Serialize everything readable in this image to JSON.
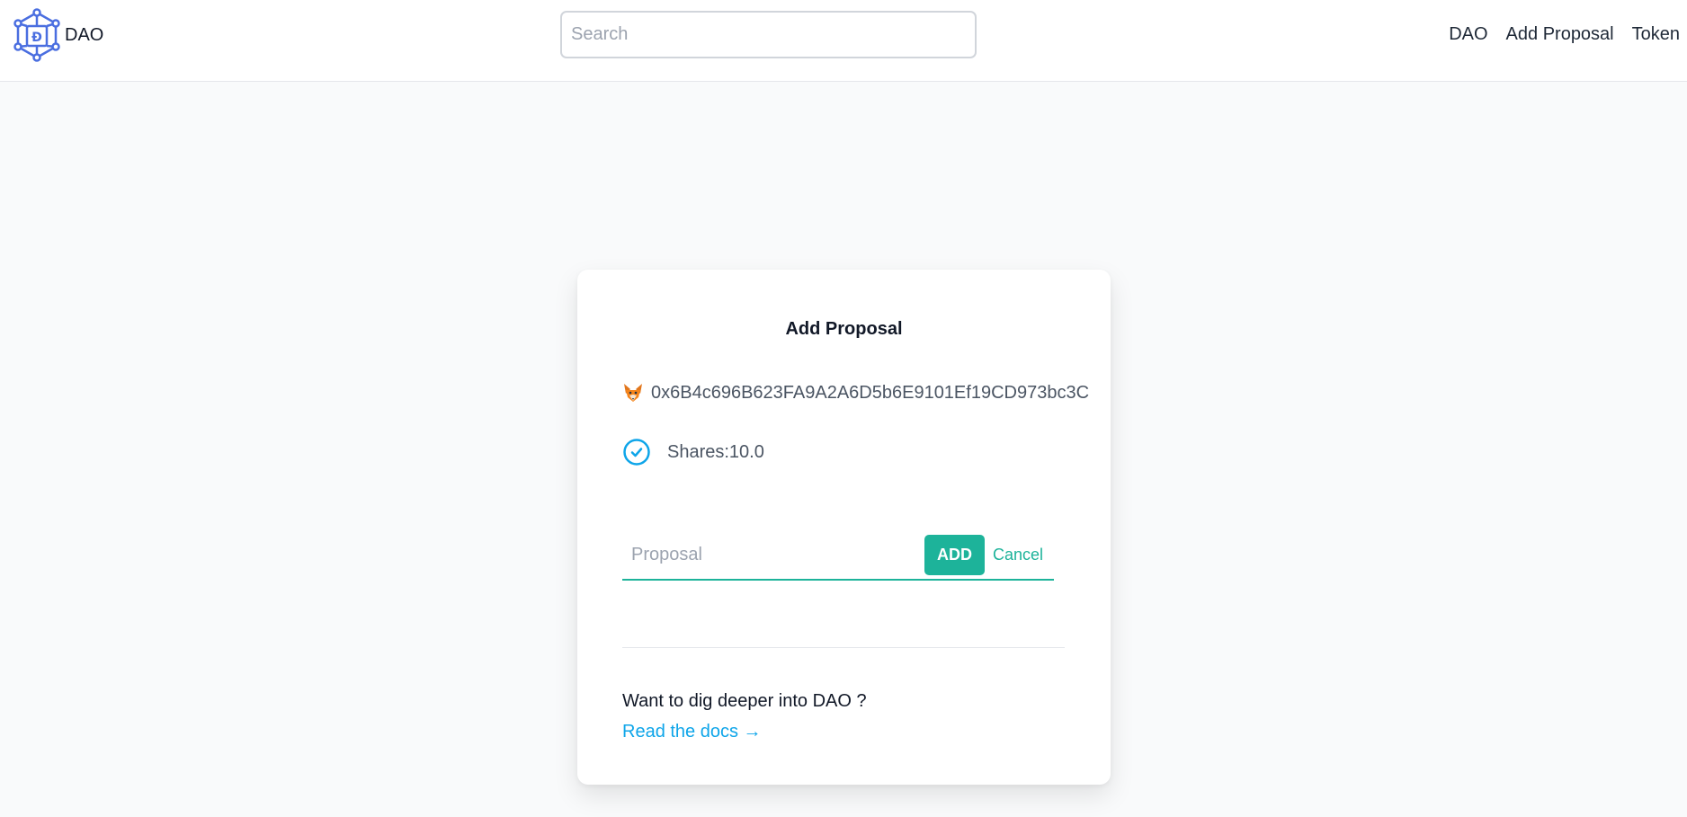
{
  "header": {
    "brand_name": "DAO",
    "search_placeholder": "Search",
    "nav": [
      "DAO",
      "Add Proposal",
      "Token"
    ]
  },
  "card": {
    "title": "Add Proposal",
    "wallet_address": "0x6B4c696B623FA9A2A6D5b6E9101Ef19CD973bc3C",
    "shares_text": "Shares:10.0",
    "proposal_placeholder": "Proposal",
    "add_label": "ADD",
    "cancel_label": "Cancel",
    "docs_question": "Want to dig deeper into DAO ?",
    "docs_link": "Read the docs →"
  },
  "icons": {
    "logo": "dao-cube-logo",
    "wallet": "metamask-fox-icon",
    "shares": "check-circle-icon"
  },
  "colors": {
    "accent": "#1db39a",
    "link": "#0ea5e9",
    "logo": "#4a6ee0"
  }
}
